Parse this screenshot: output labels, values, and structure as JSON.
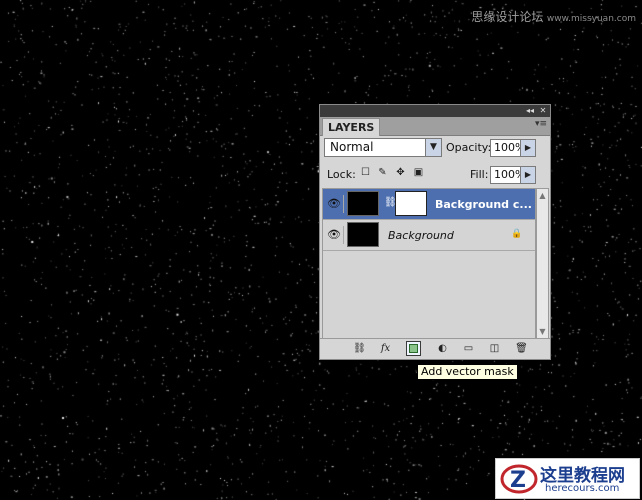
{
  "watermark": {
    "cn": "思缘设计论坛",
    "url": "www.missyuan.com"
  },
  "panel": {
    "tab_label": "LAYERS",
    "collapse_glyph": "◂◂",
    "close_glyph": "✕",
    "menu_glyph": "▾≡",
    "blend_mode": "Normal",
    "opacity_label": "Opacity:",
    "opacity_value": "100%",
    "lock_label": "Lock:",
    "fill_label": "Fill:",
    "fill_value": "100%",
    "layers": [
      {
        "name": "Background c...",
        "selected": true,
        "has_mask": true
      },
      {
        "name": "Background",
        "selected": false,
        "locked": true
      }
    ],
    "icons": {
      "visibility": "eye-icon",
      "link": "link-icon",
      "fx": "fx-icon",
      "mask": "vector-mask-icon",
      "adjustment": "adjustment-layer-icon",
      "group": "new-group-icon",
      "new_layer": "new-layer-icon",
      "delete": "trash-icon"
    },
    "fx_text": "fx"
  },
  "tooltip": "Add vector mask",
  "logo": {
    "cn": "这里教程网",
    "en": "herecours.com"
  }
}
